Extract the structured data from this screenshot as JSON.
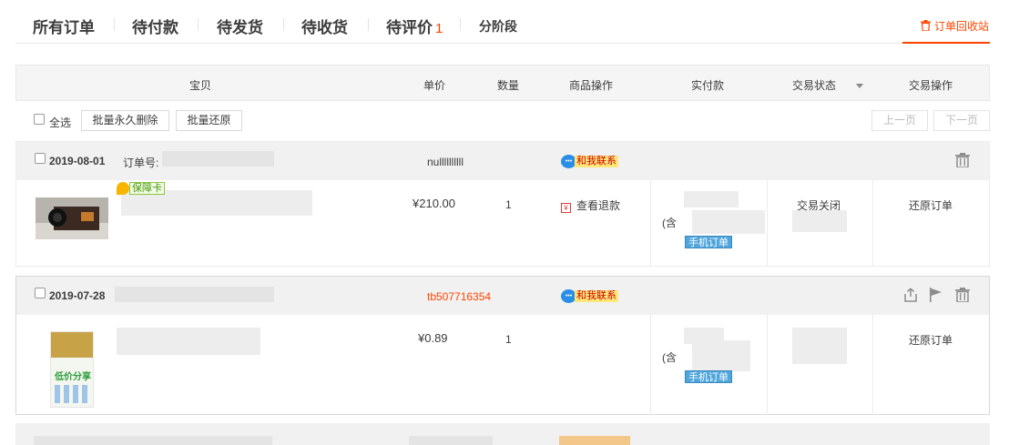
{
  "tabs": [
    {
      "label": "所有订单"
    },
    {
      "label": "待付款"
    },
    {
      "label": "待发货"
    },
    {
      "label": "待收货"
    },
    {
      "label": "待评价",
      "count": "1"
    },
    {
      "label": "分阶段"
    }
  ],
  "recycle_bin": {
    "label": "订单回收站",
    "icon": "trash-icon"
  },
  "table_header": {
    "item": "宝贝",
    "unit_price": "单价",
    "quantity": "数量",
    "item_ops": "商品操作",
    "paid": "实付款",
    "status": "交易状态",
    "ops": "交易操作"
  },
  "toolbar": {
    "select_all": "全选",
    "bulk_delete": "批量永久删除",
    "bulk_restore": "批量还原",
    "prev_page": "上一页",
    "next_page": "下一页"
  },
  "orders": [
    {
      "date": "2019-08-01",
      "order_no_label": "订单号:",
      "seller": "nullllllllll",
      "contact": "和我联系",
      "price": "¥210.00",
      "quantity": "1",
      "item_action": "查看退款",
      "guarantee": "保障卡",
      "paid_prefix": "(含",
      "mobile_badge": "手机订单",
      "status": "交易关闭",
      "action": "还原订单"
    },
    {
      "date": "2019-07-28",
      "seller": "tb507716354",
      "contact": "和我联系",
      "price": "¥0.89",
      "quantity": "1",
      "paid_prefix": "(含",
      "mobile_badge": "手机订单",
      "action": "还原订单",
      "thumb_text": "低价分享"
    }
  ],
  "colors": {
    "accent": "#ff4400",
    "header_bg": "#f5f5f5",
    "order_head_bg": "#f1f1f1",
    "badge_blue": "#4fa5dc"
  }
}
